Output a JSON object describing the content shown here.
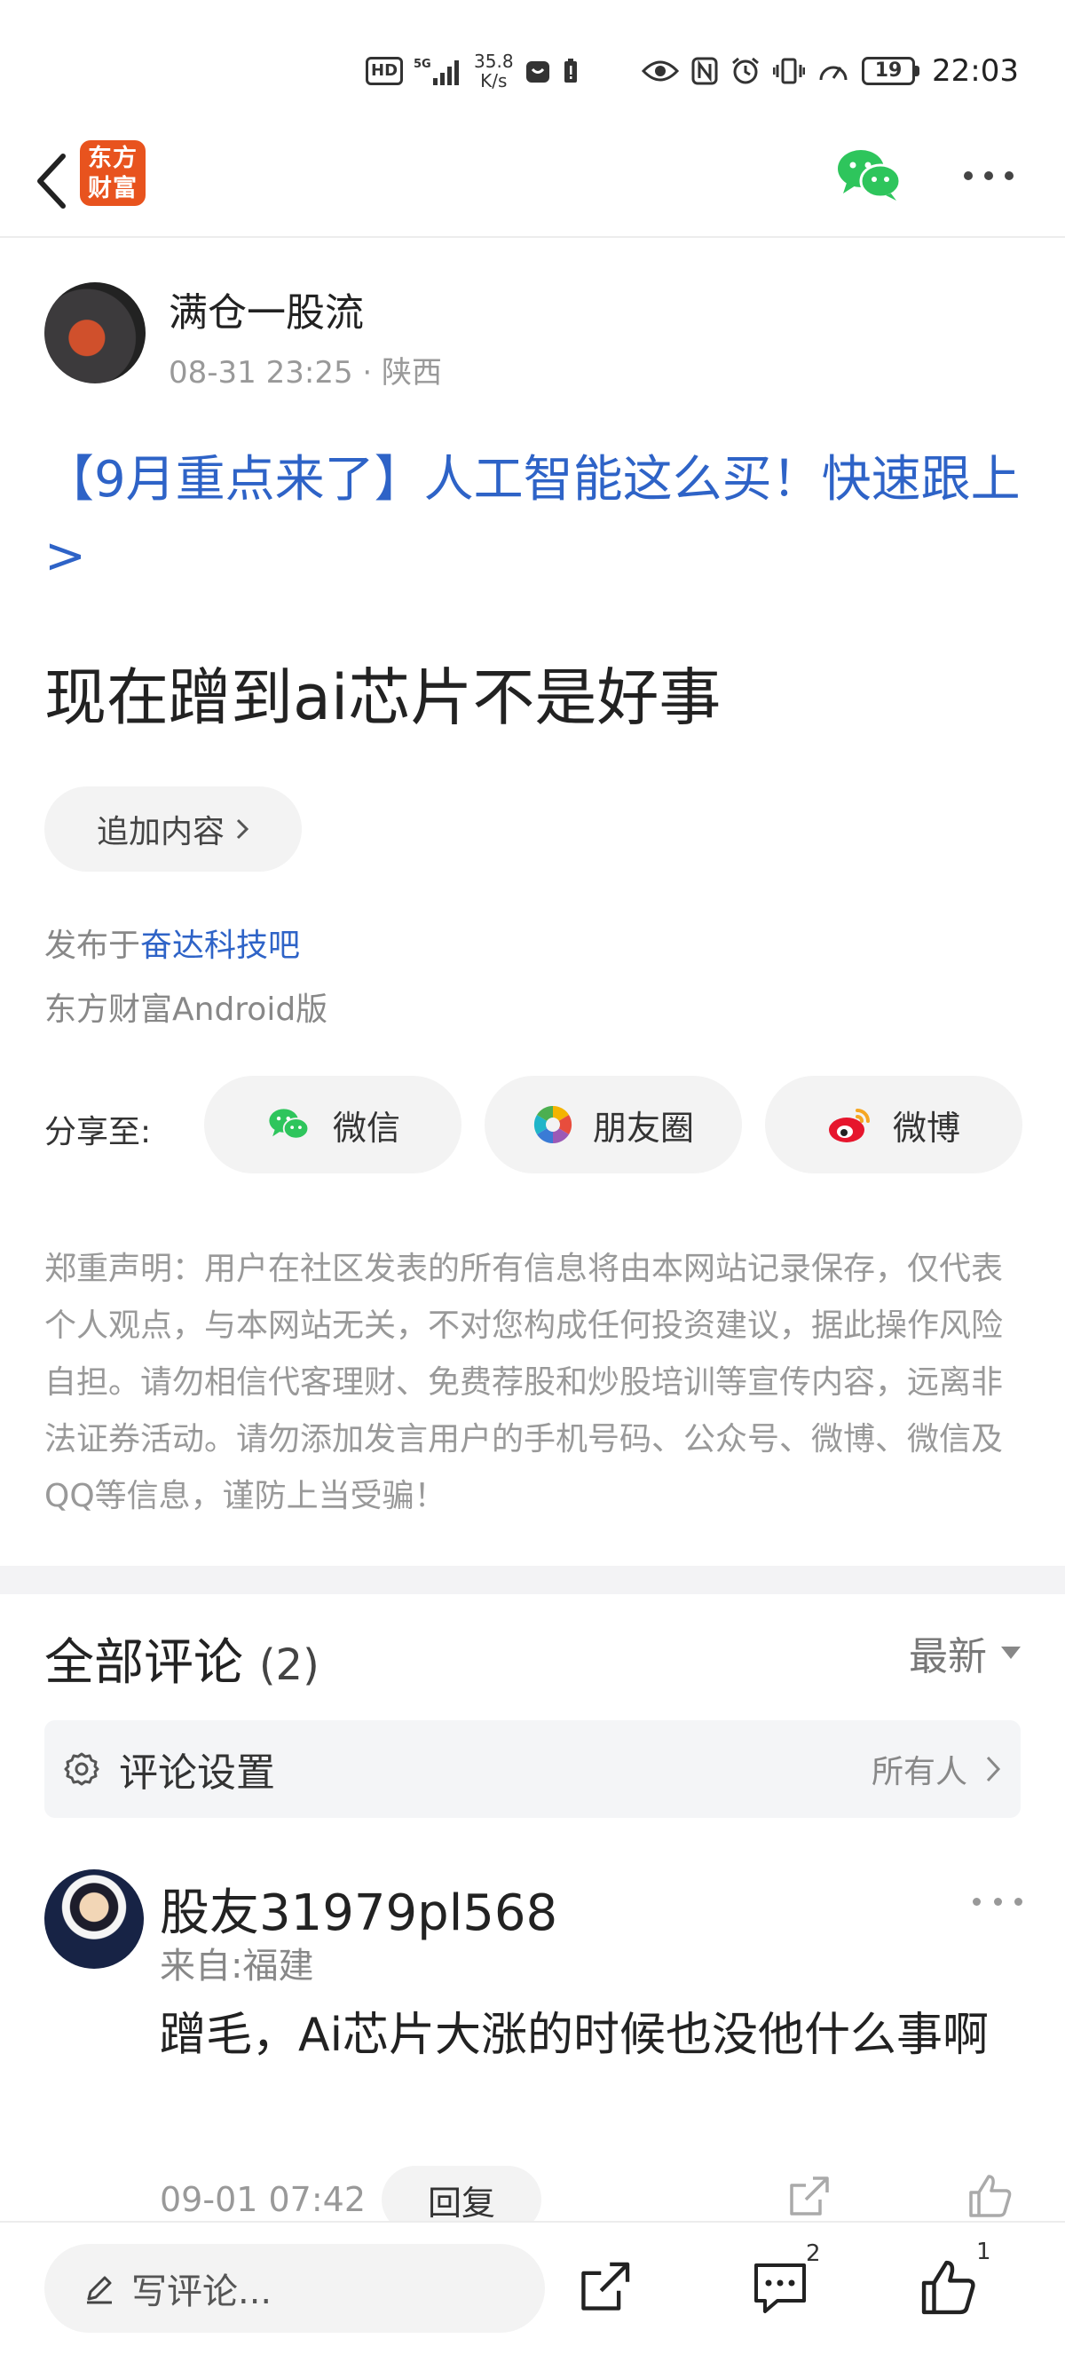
{
  "status_bar": {
    "speed_value": "35.8",
    "speed_unit": "K/s",
    "battery": "19",
    "time": "22:03"
  },
  "header": {
    "brand_line1": "东方",
    "brand_line2": "财富"
  },
  "author": {
    "name": "满仓一股流",
    "meta": "08-31 23:25 · 陕西"
  },
  "post": {
    "promo_link": "【9月重点来了】人工智能这么买！快速跟上>",
    "body": "现在蹭到ai芯片不是好事",
    "append_label": "追加内容",
    "posted_in_prefix": "发布于",
    "forum_name": "奋达科技吧",
    "client": "东方财富Android版"
  },
  "share": {
    "label": "分享至:",
    "wechat": "微信",
    "moments": "朋友圈",
    "weibo": "微博"
  },
  "disclaimer": "郑重声明：用户在社区发表的所有信息将由本网站记录保存，仅代表个人观点，与本网站无关，不对您构成任何投资建议，据此操作风险自担。请勿相信代客理财、免费荐股和炒股培训等宣传内容，远离非法证券活动。请勿添加发言用户的手机号码、公众号、微博、微信及QQ等信息，谨防上当受骗！",
  "comments": {
    "title": "全部评论",
    "count": "(2)",
    "sort": "最新",
    "settings_label": "评论设置",
    "settings_value": "所有人",
    "items": [
      {
        "user": "股友31979pl568",
        "location": "来自:福建",
        "text": "蹭毛，Ai芯片大涨的时候也没他什么事啊",
        "time": "09-01 07:42",
        "reply_label": "回复"
      }
    ]
  },
  "bottom_bar": {
    "placeholder": "写评论...",
    "comment_count": "2",
    "like_count": "1"
  },
  "colors": {
    "link_blue": "#2e63c7",
    "brand_orange": "#e8531e",
    "wechat_green": "#2ec55c",
    "weibo_red": "#e6162d"
  }
}
